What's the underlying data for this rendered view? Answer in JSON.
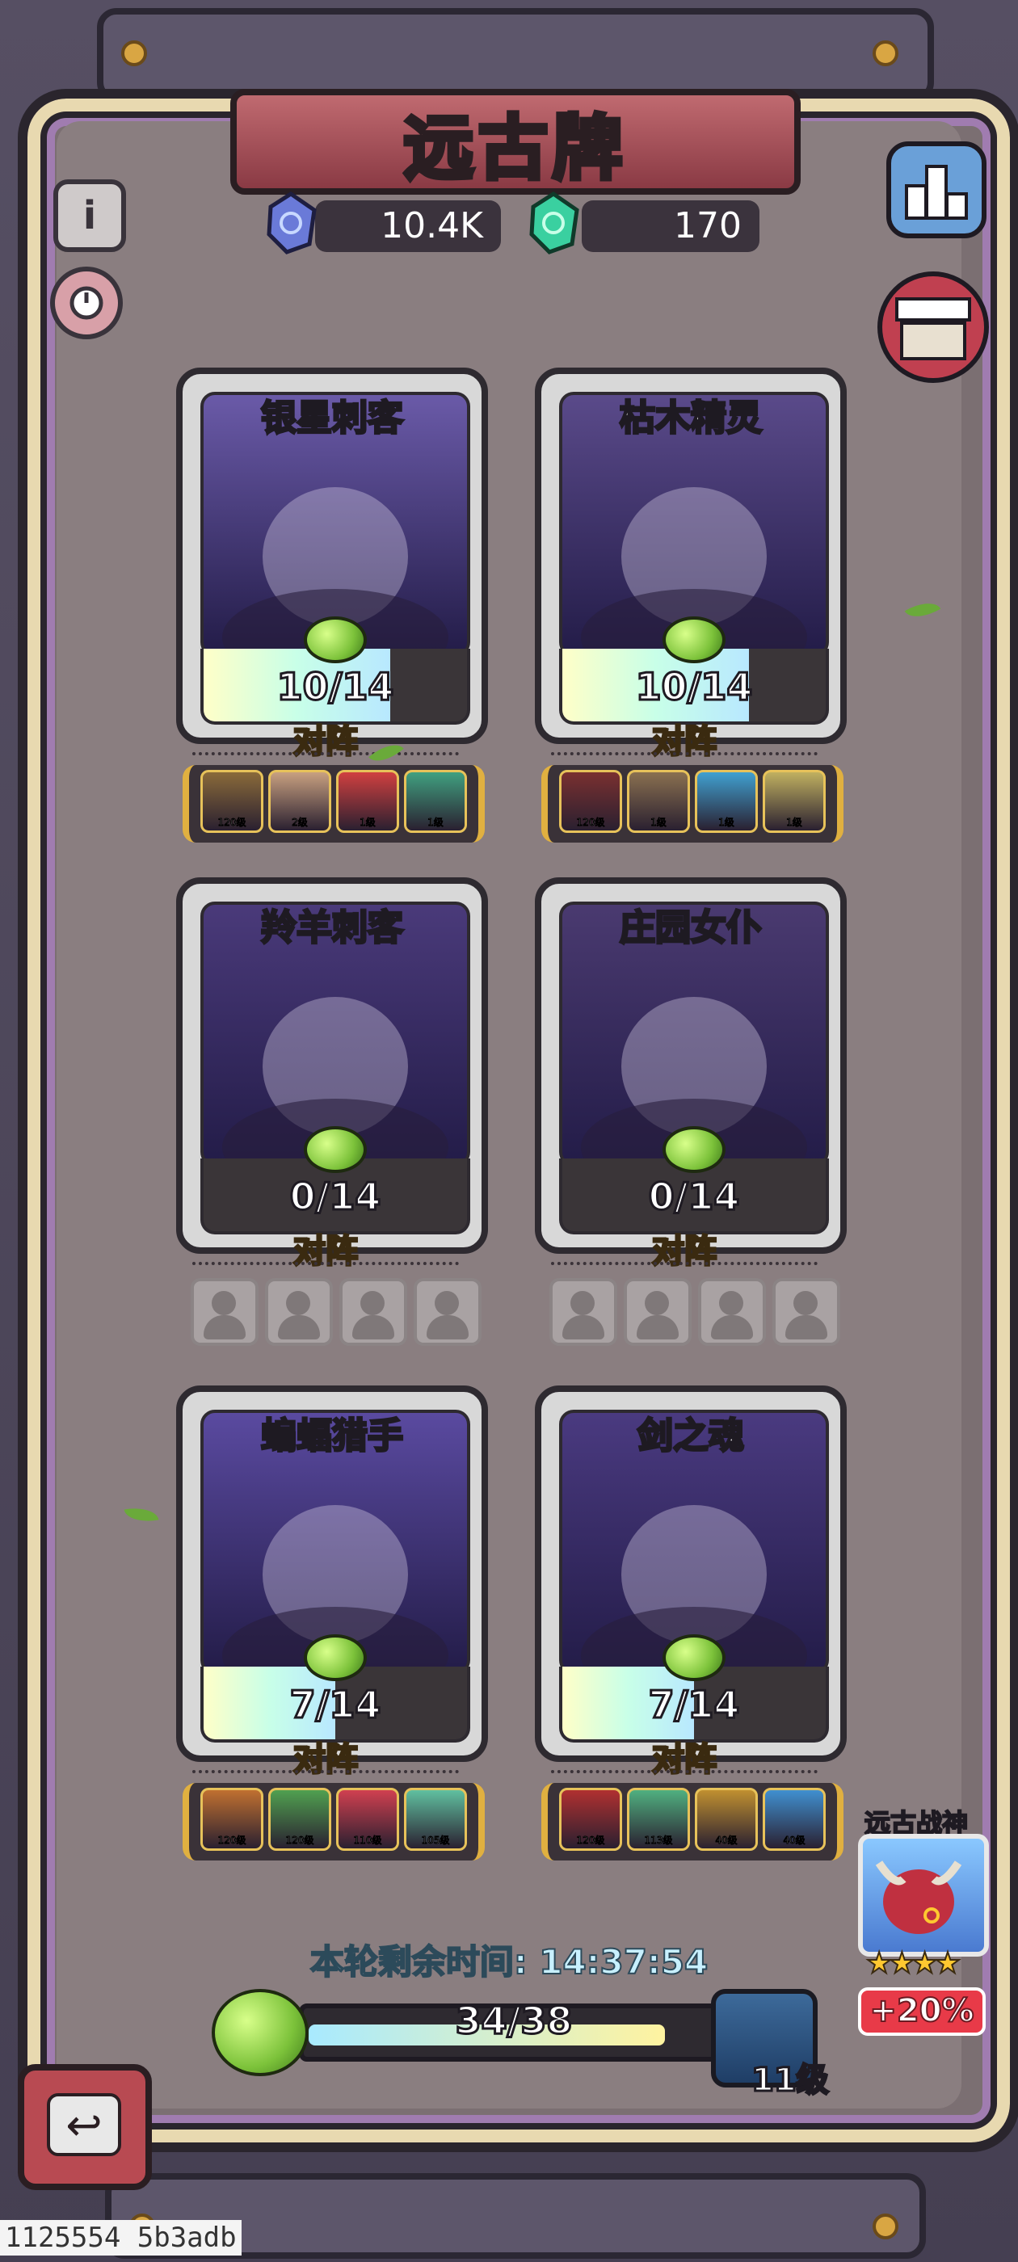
{
  "title": "远古牌",
  "resources": {
    "blue_gem": "10.4K",
    "green_gem": "170"
  },
  "icons": {
    "info": "i",
    "back": "↩"
  },
  "cards": [
    {
      "name": "银星刺客",
      "progress": "10/14",
      "fill": 0.71,
      "label": "对阵",
      "art": "#6a5aa8",
      "team": [
        {
          "level": "120级",
          "color": "#8a6a3a"
        },
        {
          "level": "2级",
          "color": "#c8a080"
        },
        {
          "level": "1级",
          "color": "#d04040"
        },
        {
          "level": "1级",
          "color": "#40a080"
        }
      ]
    },
    {
      "name": "枯木精灵",
      "progress": "10/14",
      "fill": 0.71,
      "label": "对阵",
      "art": "#5a4a8a",
      "team": [
        {
          "level": "120级",
          "color": "#7a3030"
        },
        {
          "level": "1级",
          "color": "#8a7050"
        },
        {
          "level": "1级",
          "color": "#40a0d0"
        },
        {
          "level": "1级",
          "color": "#c0b060"
        }
      ]
    },
    {
      "name": "羚羊刺客",
      "progress": "0/14",
      "fill": 0,
      "label": "对阵",
      "art": "#4a3a7a",
      "team": []
    },
    {
      "name": "庄园女仆",
      "progress": "0/14",
      "fill": 0,
      "label": "对阵",
      "art": "#4a3a70",
      "team": []
    },
    {
      "name": "蝙蝠猎手",
      "progress": "7/14",
      "fill": 0.5,
      "label": "对阵",
      "art": "#5a4aa0",
      "team": [
        {
          "level": "120级",
          "color": "#c07030"
        },
        {
          "level": "120级",
          "color": "#50a050"
        },
        {
          "level": "110级",
          "color": "#d04050"
        },
        {
          "level": "105级",
          "color": "#60c0a0"
        }
      ]
    },
    {
      "name": "剑之魂",
      "progress": "7/14",
      "fill": 0.5,
      "label": "对阵",
      "art": "#4a3a80",
      "team": [
        {
          "level": "120级",
          "color": "#b03030"
        },
        {
          "level": "113级",
          "color": "#50b080"
        },
        {
          "level": "40级",
          "color": "#c09030"
        },
        {
          "level": "40级",
          "color": "#4090d0"
        }
      ]
    }
  ],
  "timer": "本轮剩余时间: 14:37:54",
  "bottom_progress": {
    "text": "34/38",
    "fill": 0.89,
    "level": "11级"
  },
  "god": {
    "title": "远古战神",
    "stars": "★★★★",
    "bonus": "+20%"
  },
  "footer_id": "1125554 5b3adb"
}
